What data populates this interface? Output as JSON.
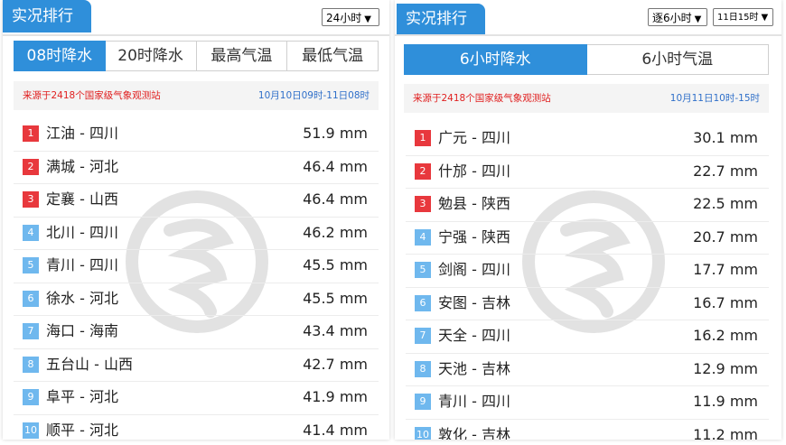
{
  "left": {
    "title": "实况排行",
    "period_select": "24小时",
    "tabs": [
      "08时降水",
      "20时降水",
      "最高气温",
      "最低气温"
    ],
    "active_tab": 0,
    "source": "来源于2418个国家级气象观测站",
    "time_range": "10月10日09时-11日08时",
    "rows": [
      {
        "rank": "1",
        "name": "江油 - 四川",
        "value": "51.9 mm"
      },
      {
        "rank": "2",
        "name": "满城 - 河北",
        "value": "46.4 mm"
      },
      {
        "rank": "3",
        "name": "定襄 - 山西",
        "value": "46.4 mm"
      },
      {
        "rank": "4",
        "name": "北川 - 四川",
        "value": "46.2 mm"
      },
      {
        "rank": "5",
        "name": "青川 - 四川",
        "value": "45.5 mm"
      },
      {
        "rank": "6",
        "name": "徐水 - 河北",
        "value": "45.5 mm"
      },
      {
        "rank": "7",
        "name": "海口 - 海南",
        "value": "43.4 mm"
      },
      {
        "rank": "8",
        "name": "五台山 - 山西",
        "value": "42.7 mm"
      },
      {
        "rank": "9",
        "name": "阜平 - 河北",
        "value": "41.9 mm"
      },
      {
        "rank": "10",
        "name": "顺平 - 河北",
        "value": "41.4 mm"
      }
    ]
  },
  "right": {
    "title": "实况排行",
    "interval_select": "逐6小时",
    "time_select": "11日15时",
    "tabs": [
      "6小时降水",
      "6小时气温"
    ],
    "active_tab": 0,
    "source": "来源于2418个国家级气象观测站",
    "time_range": "10月11日10时-15时",
    "rows": [
      {
        "rank": "1",
        "name": "广元 - 四川",
        "value": "30.1 mm"
      },
      {
        "rank": "2",
        "name": "什邡 - 四川",
        "value": "22.7 mm"
      },
      {
        "rank": "3",
        "name": "勉县 - 陕西",
        "value": "22.5 mm"
      },
      {
        "rank": "4",
        "name": "宁强 - 陕西",
        "value": "20.7 mm"
      },
      {
        "rank": "5",
        "name": "剑阁 - 四川",
        "value": "17.7 mm"
      },
      {
        "rank": "6",
        "name": "安图 - 吉林",
        "value": "16.7 mm"
      },
      {
        "rank": "7",
        "name": "天全 - 四川",
        "value": "16.2 mm"
      },
      {
        "rank": "8",
        "name": "天池 - 吉林",
        "value": "12.9 mm"
      },
      {
        "rank": "9",
        "name": "青川 - 四川",
        "value": "11.9 mm"
      },
      {
        "rank": "10",
        "name": "敦化 - 吉林",
        "value": "11.2 mm"
      }
    ]
  },
  "colors": {
    "accent": "#2f8fda",
    "top_rank": "#e8383d",
    "other_rank": "#6fb8ee",
    "source_text": "#e02020",
    "time_text": "#2f6fc9"
  },
  "icons": {
    "dropdown": "chevron-down-icon",
    "watermark": "logo-watermark-icon"
  }
}
